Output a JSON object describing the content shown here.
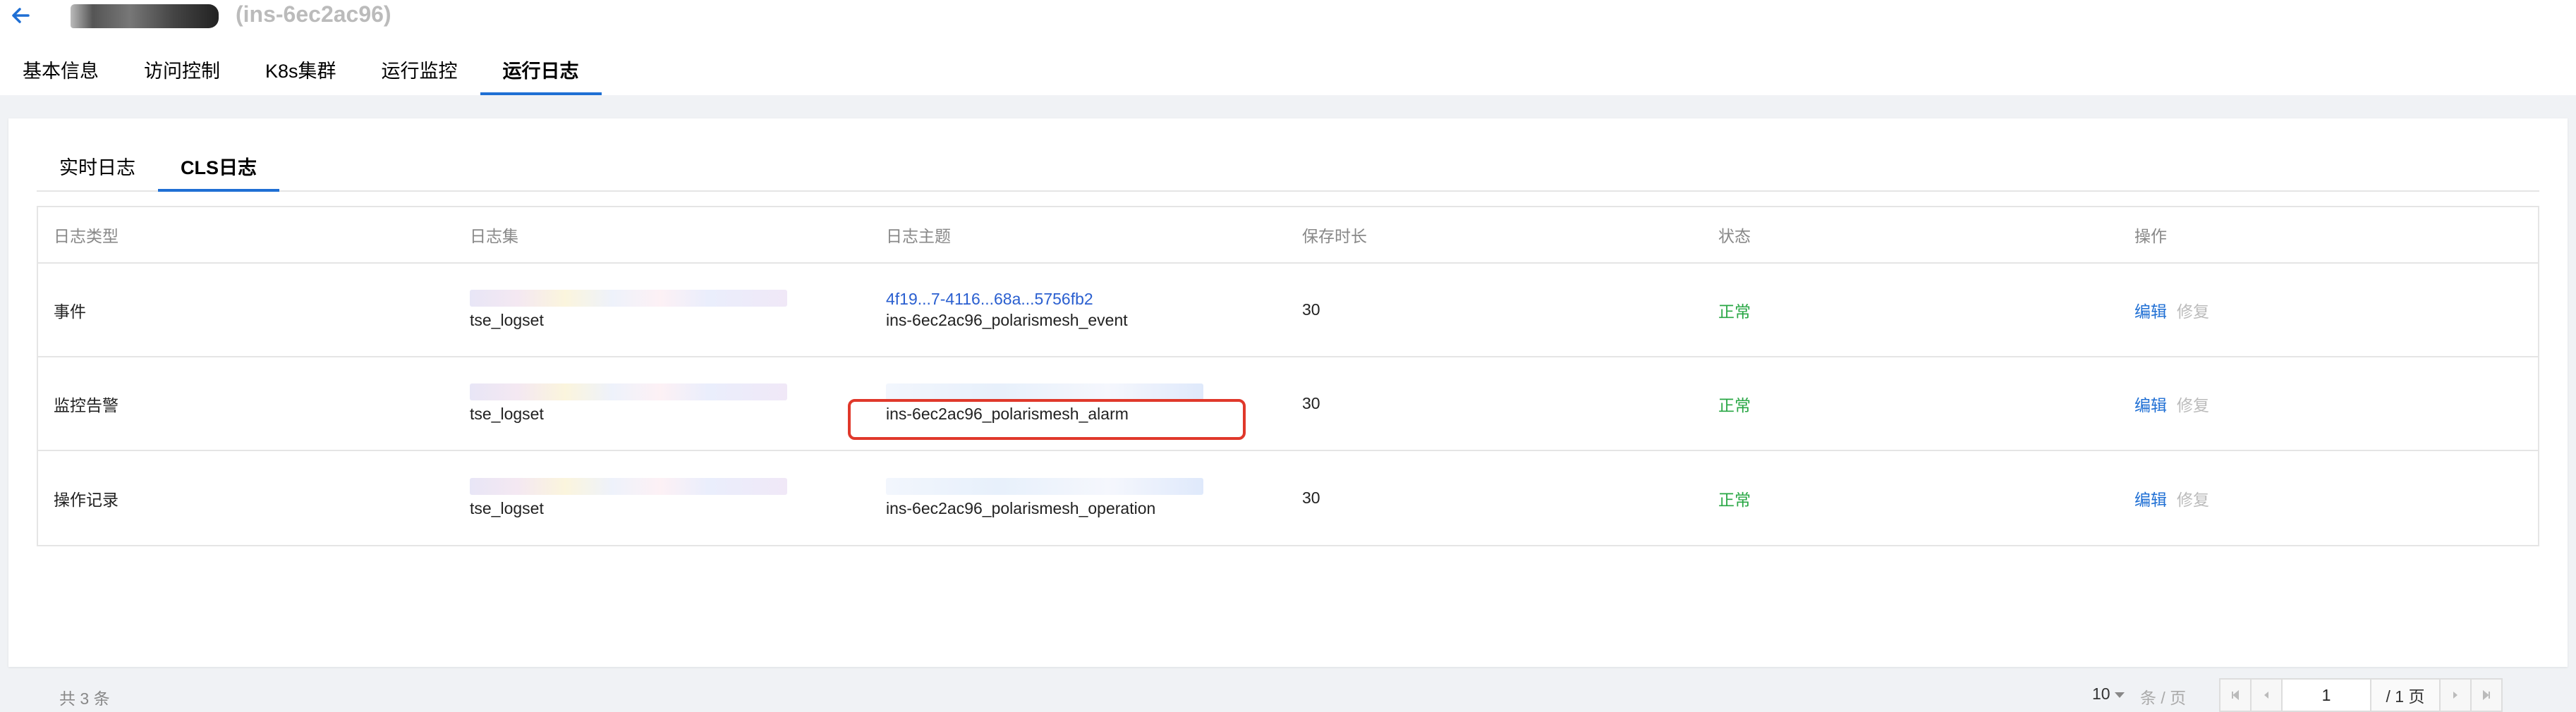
{
  "header": {
    "instance_id": "(ins-6ec2ac96)"
  },
  "main_tabs": [
    {
      "label": "基本信息"
    },
    {
      "label": "访问控制"
    },
    {
      "label": "K8s集群"
    },
    {
      "label": "运行监控"
    },
    {
      "label": "运行日志",
      "active": true
    }
  ],
  "sub_tabs": [
    {
      "label": "实时日志"
    },
    {
      "label": "CLS日志",
      "active": true
    }
  ],
  "table": {
    "columns": [
      "日志类型",
      "日志集",
      "日志主题",
      "保存时长",
      "状态",
      "操作"
    ],
    "rows": [
      {
        "type": "事件",
        "logset": "tse_logset",
        "topic_id": "4f19...7-4116...68a...5756fb2",
        "topic": "ins-6ec2ac96_polarismesh_event",
        "retention": "30",
        "status": "正常",
        "edit": "编辑",
        "repair": "修复"
      },
      {
        "type": "监控告警",
        "logset": "tse_logset",
        "topic": "ins-6ec2ac96_polarismesh_alarm",
        "retention": "30",
        "status": "正常",
        "edit": "编辑",
        "repair": "修复"
      },
      {
        "type": "操作记录",
        "logset": "tse_logset",
        "topic": "ins-6ec2ac96_polarismesh_operation",
        "retention": "30",
        "status": "正常",
        "edit": "编辑",
        "repair": "修复"
      }
    ]
  },
  "footer": {
    "total": "共 3 条",
    "page_size": "10",
    "per_page_label": "条 / 页",
    "current_page": "1",
    "total_pages": "/ 1 页"
  },
  "colors": {
    "accent": "#1f6fd4",
    "status_ok": "#29a745",
    "highlight": "#e0382b"
  }
}
